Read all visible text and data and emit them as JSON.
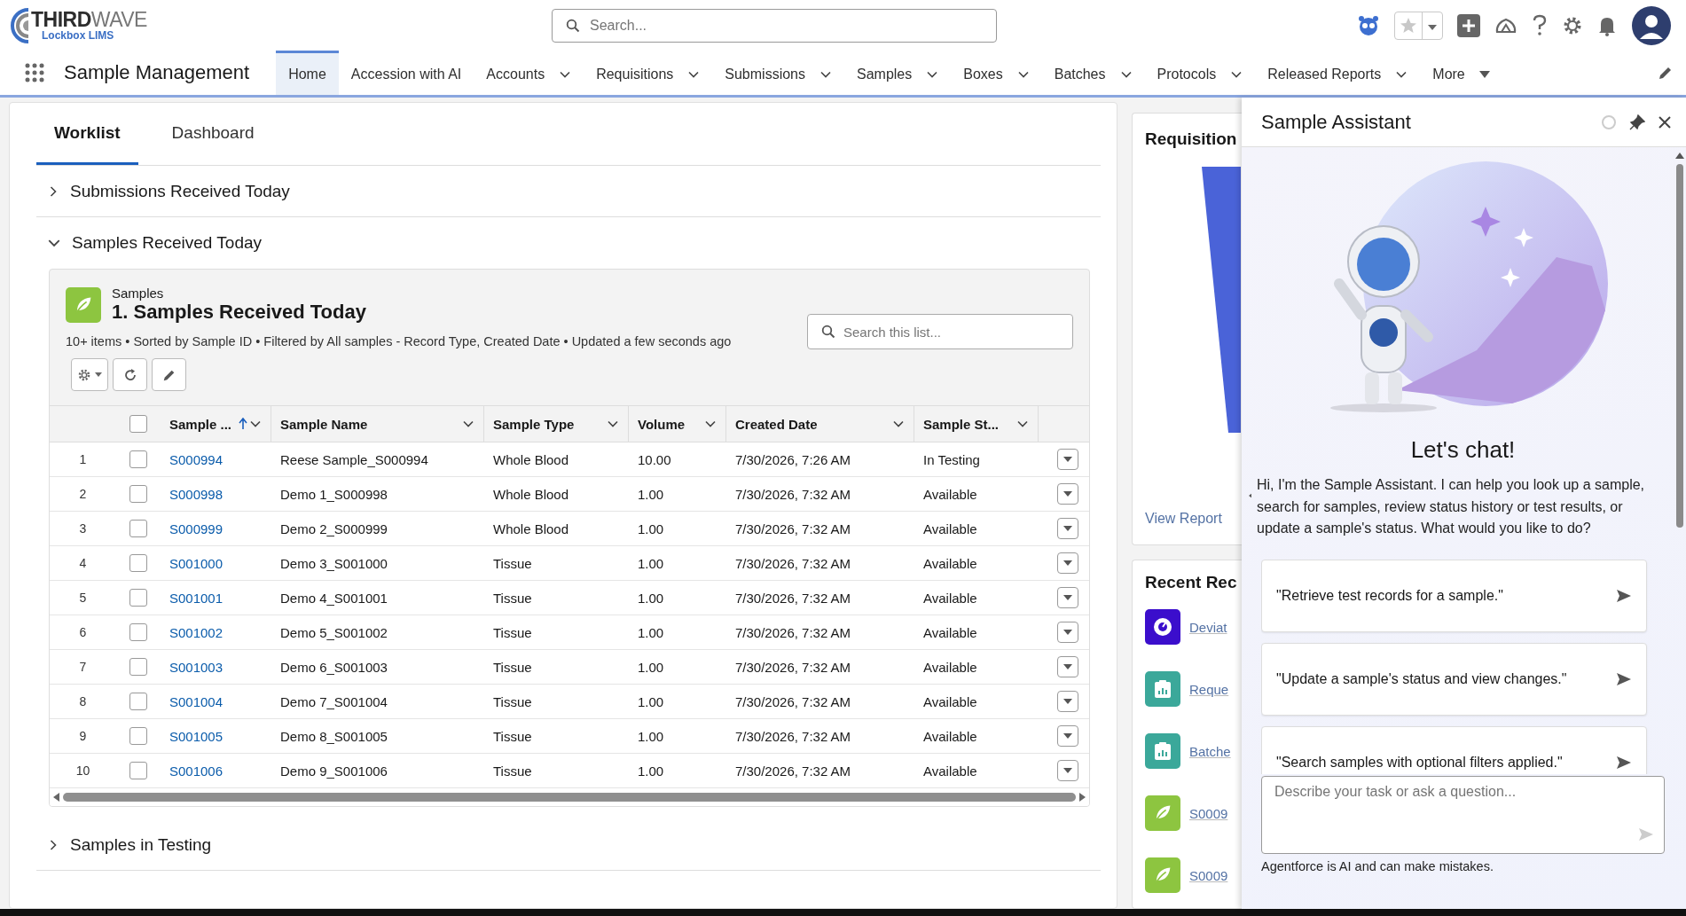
{
  "logo": {
    "word_1": "THIRD",
    "word_2": "WAVE",
    "subtitle": "Lockbox LIMS"
  },
  "search": {
    "placeholder": "Search..."
  },
  "app_name": "Sample Management",
  "nav": [
    {
      "label": "Home",
      "kind": "link",
      "selected": true
    },
    {
      "label": "Accession with AI",
      "kind": "link",
      "selected": false
    },
    {
      "label": "Accounts",
      "kind": "menu",
      "selected": false
    },
    {
      "label": "Requisitions",
      "kind": "menu",
      "selected": false
    },
    {
      "label": "Submissions",
      "kind": "menu",
      "selected": false
    },
    {
      "label": "Samples",
      "kind": "menu",
      "selected": false
    },
    {
      "label": "Boxes",
      "kind": "menu",
      "selected": false
    },
    {
      "label": "Batches",
      "kind": "menu",
      "selected": false
    },
    {
      "label": "Protocols",
      "kind": "menu",
      "selected": false
    },
    {
      "label": "Released Reports",
      "kind": "menu",
      "selected": false
    },
    {
      "label": "More",
      "kind": "more",
      "selected": false
    }
  ],
  "tabs": [
    {
      "label": "Worklist",
      "selected": true
    },
    {
      "label": "Dashboard",
      "selected": false
    }
  ],
  "sections": [
    {
      "title": "Submissions Received Today",
      "expanded": false
    },
    {
      "title": "Samples Received Today",
      "expanded": true
    },
    {
      "title": "Samples in Testing",
      "expanded": false
    }
  ],
  "list": {
    "object": "Samples",
    "title": "1. Samples Received Today",
    "summary": "10+ items • Sorted by Sample ID • Filtered by All samples - Record Type, Created Date • Updated a few seconds ago",
    "search_placeholder": "Search this list...",
    "all_checked": false,
    "columns": [
      {
        "label": "Sample ...",
        "sorted": true
      },
      {
        "label": "Sample Name",
        "sorted": false
      },
      {
        "label": "Sample Type",
        "sorted": false
      },
      {
        "label": "Volume",
        "sorted": false
      },
      {
        "label": "Created Date",
        "sorted": false
      },
      {
        "label": "Sample St...",
        "sorted": false
      }
    ],
    "rows": [
      {
        "number": "1",
        "checked": false,
        "sample_id": "S000994",
        "name": "Reese Sample_S000994",
        "type": "Whole Blood",
        "volume": "10.00",
        "created": "7/30/2026, 7:26 AM",
        "status": "In Testing"
      },
      {
        "number": "2",
        "checked": false,
        "sample_id": "S000998",
        "name": "Demo 1_S000998",
        "type": "Whole Blood",
        "volume": "1.00",
        "created": "7/30/2026, 7:32 AM",
        "status": "Available"
      },
      {
        "number": "3",
        "checked": false,
        "sample_id": "S000999",
        "name": "Demo 2_S000999",
        "type": "Whole Blood",
        "volume": "1.00",
        "created": "7/30/2026, 7:32 AM",
        "status": "Available"
      },
      {
        "number": "4",
        "checked": false,
        "sample_id": "S001000",
        "name": "Demo 3_S001000",
        "type": "Tissue",
        "volume": "1.00",
        "created": "7/30/2026, 7:32 AM",
        "status": "Available"
      },
      {
        "number": "5",
        "checked": false,
        "sample_id": "S001001",
        "name": "Demo 4_S001001",
        "type": "Tissue",
        "volume": "1.00",
        "created": "7/30/2026, 7:32 AM",
        "status": "Available"
      },
      {
        "number": "6",
        "checked": false,
        "sample_id": "S001002",
        "name": "Demo 5_S001002",
        "type": "Tissue",
        "volume": "1.00",
        "created": "7/30/2026, 7:32 AM",
        "status": "Available"
      },
      {
        "number": "7",
        "checked": false,
        "sample_id": "S001003",
        "name": "Demo 6_S001003",
        "type": "Tissue",
        "volume": "1.00",
        "created": "7/30/2026, 7:32 AM",
        "status": "Available"
      },
      {
        "number": "8",
        "checked": false,
        "sample_id": "S001004",
        "name": "Demo 7_S001004",
        "type": "Tissue",
        "volume": "1.00",
        "created": "7/30/2026, 7:32 AM",
        "status": "Available"
      },
      {
        "number": "9",
        "checked": false,
        "sample_id": "S001005",
        "name": "Demo 8_S001005",
        "type": "Tissue",
        "volume": "1.00",
        "created": "7/30/2026, 7:32 AM",
        "status": "Available"
      },
      {
        "number": "10",
        "checked": false,
        "sample_id": "S001006",
        "name": "Demo 9_S001006",
        "type": "Tissue",
        "volume": "1.00",
        "created": "7/30/2026, 7:32 AM",
        "status": "Available"
      }
    ]
  },
  "chart_card": {
    "title": "Requisition",
    "link": "View Report"
  },
  "recent": {
    "title": "Recent Rec",
    "items": [
      {
        "label": "Deviat",
        "kind": "deviation"
      },
      {
        "label": "Reque",
        "kind": "report"
      },
      {
        "label": "Batche",
        "kind": "report"
      },
      {
        "label": "S0009",
        "kind": "sample"
      },
      {
        "label": "S0009",
        "kind": "sample"
      }
    ]
  },
  "assistant": {
    "title": "Sample Assistant",
    "heading": "Let's chat!",
    "intro": "Hi, I'm the Sample Assistant. I can help you look up a sample, search for samples, review status history or test results, or update a sample's status. What would you like to do?",
    "suggestions": [
      "\"Retrieve test records for a sample.\"",
      "\"Update a sample's status and view changes.\"",
      "\"Search samples with optional filters applied.\""
    ],
    "input_placeholder": "Describe your task or ask a question...",
    "disclaimer": "Agentforce is AI and can make mistakes."
  }
}
